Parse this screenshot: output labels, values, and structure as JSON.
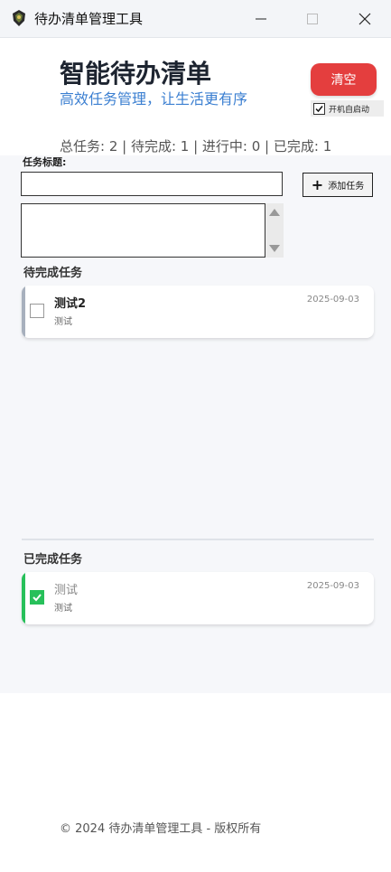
{
  "window": {
    "title": "待办清单管理工具",
    "minimize_icon": "minimize-icon",
    "maximize_icon": "maximize-icon",
    "close_icon": "close-icon"
  },
  "header": {
    "title": "智能待办清单",
    "subtitle": "高效任务管理，让生活更有序",
    "clear_label": "清空",
    "autostart_label": "开机自启动",
    "autostart_checked": true,
    "accent_color": "#e43e3e",
    "subtitle_color": "#3b7fd1"
  },
  "stats": {
    "text": "总任务: 2 | 待完成: 1 | 进行中: 0 | 已完成: 1"
  },
  "form": {
    "title_label": "任务标题:",
    "title_value": "",
    "description_value": "",
    "add_label": "添加任务"
  },
  "pending": {
    "heading": "待完成任务",
    "tasks": [
      {
        "title": "测试2",
        "description": "测试",
        "date": "2025-09-03",
        "done": false
      }
    ]
  },
  "completed": {
    "heading": "已完成任务",
    "tasks": [
      {
        "title": "测试",
        "description": "测试",
        "date": "2025-09-03",
        "done": true,
        "accent": "#27c05a"
      }
    ]
  },
  "footer": {
    "text": "© 2024 待办清单管理工具 - 版权所有"
  }
}
